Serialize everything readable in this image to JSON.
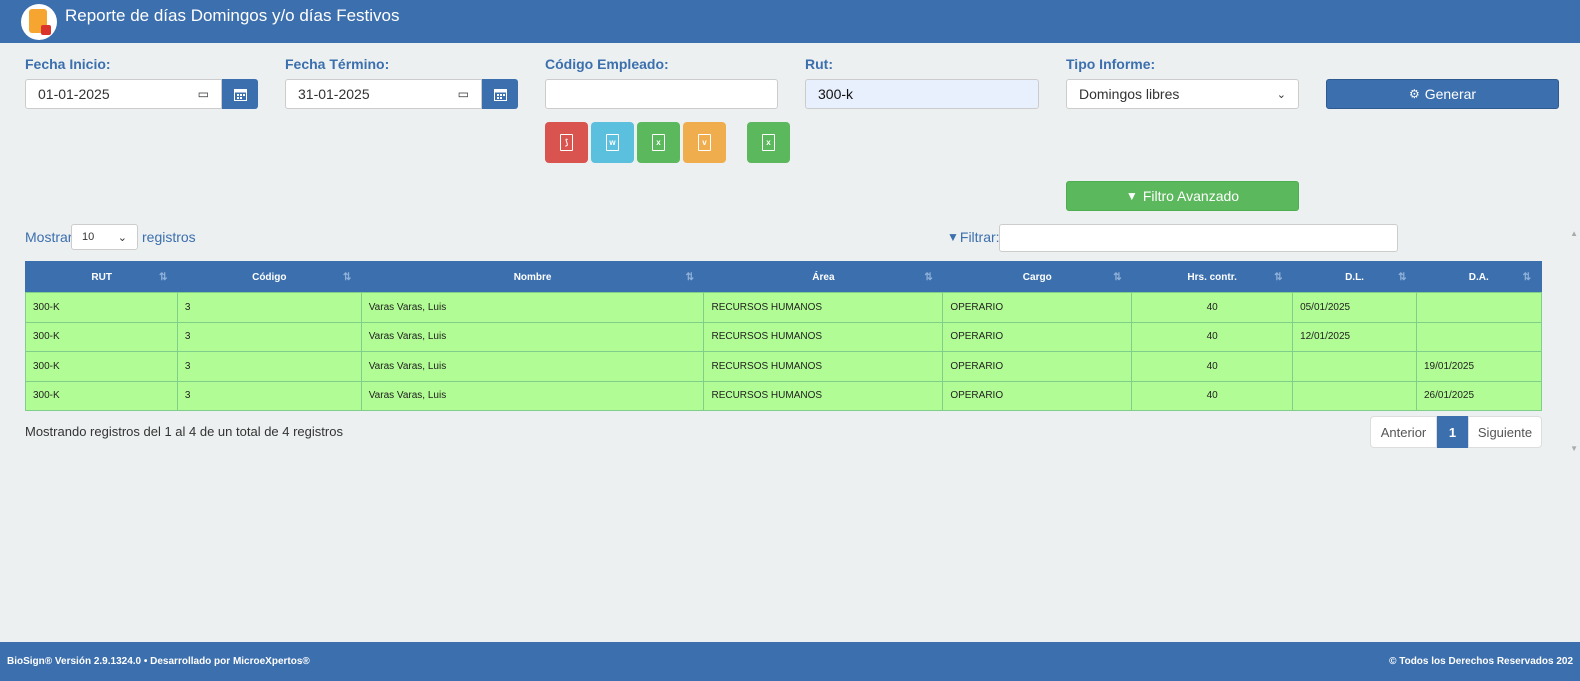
{
  "header": {
    "title": "Reporte de días Domingos y/o días Festivos"
  },
  "form": {
    "fecha_inicio_label": "Fecha Inicio:",
    "fecha_inicio_value": "01-01-2025",
    "fecha_termino_label": "Fecha Término:",
    "fecha_termino_value": "31-01-2025",
    "codigo_label": "Código Empleado:",
    "codigo_value": "",
    "rut_label": "Rut:",
    "rut_value": "300-k",
    "tipo_label": "Tipo Informe:",
    "tipo_value": "Domingos libres",
    "generar_label": "Generar",
    "filtro_label": "Filtro Avanzado"
  },
  "exports": [
    {
      "name": "pdf",
      "color": "#d9534f",
      "glyph": "PDF"
    },
    {
      "name": "word",
      "color": "#5bc0de",
      "glyph": "W"
    },
    {
      "name": "excel",
      "color": "#5cb85c",
      "glyph": "X"
    },
    {
      "name": "csv",
      "color": "#f0ad4e",
      "glyph": "V"
    },
    {
      "name": "excel-2",
      "color": "#5cb85c",
      "glyph": "X"
    }
  ],
  "table_controls": {
    "mostrar": "Mostrar",
    "page_size": "10",
    "registros": "registros",
    "filtrar": "Filtrar:"
  },
  "table": {
    "headers": [
      "RUT",
      "Código",
      "Nombre",
      "Área",
      "Cargo",
      "Hrs. contr.",
      "D.L.",
      "D.A."
    ],
    "rows": [
      [
        "300-K",
        "3",
        "Varas Varas, Luis",
        "RECURSOS HUMANOS",
        "OPERARIO",
        "40",
        "05/01/2025",
        ""
      ],
      [
        "300-K",
        "3",
        "Varas Varas, Luis",
        "RECURSOS HUMANOS",
        "OPERARIO",
        "40",
        "12/01/2025",
        ""
      ],
      [
        "300-K",
        "3",
        "Varas Varas, Luis",
        "RECURSOS HUMANOS",
        "OPERARIO",
        "40",
        "",
        "19/01/2025"
      ],
      [
        "300-K",
        "3",
        "Varas Varas, Luis",
        "RECURSOS HUMANOS",
        "OPERARIO",
        "40",
        "",
        "26/01/2025"
      ]
    ]
  },
  "pagination": {
    "info": "Mostrando registros del 1 al 4 de un total de 4 registros",
    "prev": "Anterior",
    "current": "1",
    "next": "Siguiente"
  },
  "footer": {
    "left": "BioSign® Versión 2.9.1324.0 • Desarrollado por MicroeXpertos®",
    "right": "© Todos los Derechos Reservados 202"
  },
  "colors": {
    "primary": "#3c6fad",
    "row": "#b1fc94",
    "success": "#5cb85c"
  }
}
